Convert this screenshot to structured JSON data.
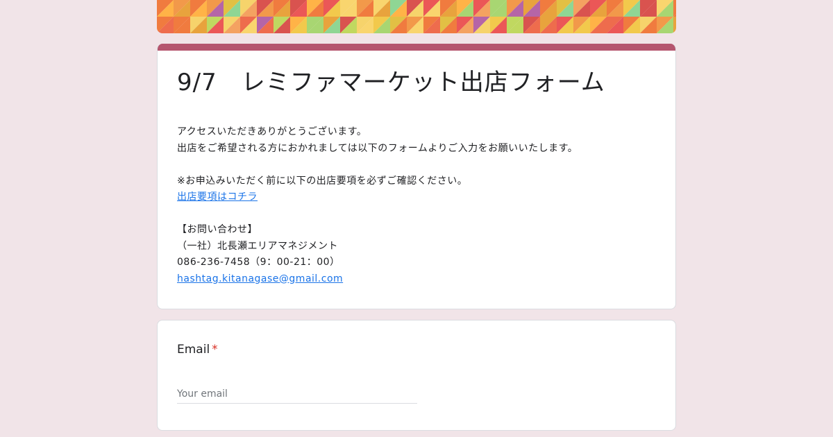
{
  "form": {
    "title": "9/7　レミファマーケット出店フォーム",
    "description": {
      "line1": "アクセスいただきありがとうございます。",
      "line2": "出店をご希望される方におかれましては以下のフォームよりご入力をお願いいたします。",
      "line3": "※お申込みいただく前に以下の出店要項を必ずご確認ください。",
      "link": "出店要項はコチラ",
      "contact_heading": "【お問い合わせ】",
      "org": "（一社）北長瀬エリアマネジメント",
      "phone": "086-236-7458（9：00-21：00）",
      "email": "hashtag.kitanagase@gmail.com"
    }
  },
  "email_question": {
    "label": "Email",
    "required_mark": "*",
    "placeholder": "Your email"
  },
  "colors": {
    "background": "#f1e4e8",
    "accent": "#b5556e",
    "link": "#1a73e8",
    "required": "#d93025"
  }
}
